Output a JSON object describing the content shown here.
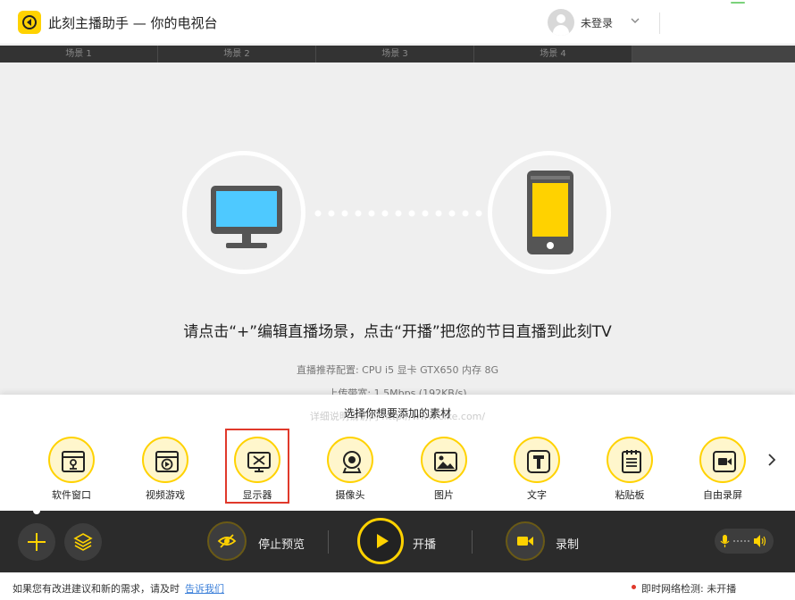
{
  "app": {
    "title": "此刻主播助手 — 你的电视台",
    "user_label": "未登录"
  },
  "scenes": [
    "场景 1",
    "场景 2",
    "场景 3",
    "场景 4"
  ],
  "preview": {
    "hint": "请点击“+”编辑直播场景，点击“开播”把您的节目直播到此刻TV",
    "config": "直播推荐配置: CPU i5  显卡 GTX650  内存 8G",
    "upload": "上传带宽: 1.5Mbps (192KB/s)"
  },
  "panel": {
    "title": "选择你想要添加的素材",
    "ghost_text": "详细说明请访问  http://www.cike.com/",
    "items": [
      {
        "label": "软件窗口",
        "icon": "app-window-icon"
      },
      {
        "label": "视频游戏",
        "icon": "video-game-icon"
      },
      {
        "label": "显示器",
        "icon": "monitor-icon"
      },
      {
        "label": "摄像头",
        "icon": "webcam-icon"
      },
      {
        "label": "图片",
        "icon": "picture-icon"
      },
      {
        "label": "文字",
        "icon": "text-icon"
      },
      {
        "label": "粘贴板",
        "icon": "clipboard-icon"
      },
      {
        "label": "自由录屏",
        "icon": "screen-record-icon"
      }
    ],
    "selected_index": 2
  },
  "toolbar": {
    "stop_preview": "停止预览",
    "go_live": "开播",
    "record": "录制"
  },
  "status": {
    "feedback": "如果您有改进建议和新的需求，请及时",
    "feedback_link": "告诉我们",
    "network_label": "即时网络检测:",
    "network_value": "未开播"
  },
  "colors": {
    "accent": "#ffd200",
    "toolbar_bg": "#2b2b2b",
    "preview_bg": "#efefef",
    "selection": "#e0392b",
    "link": "#3b7fd9"
  }
}
